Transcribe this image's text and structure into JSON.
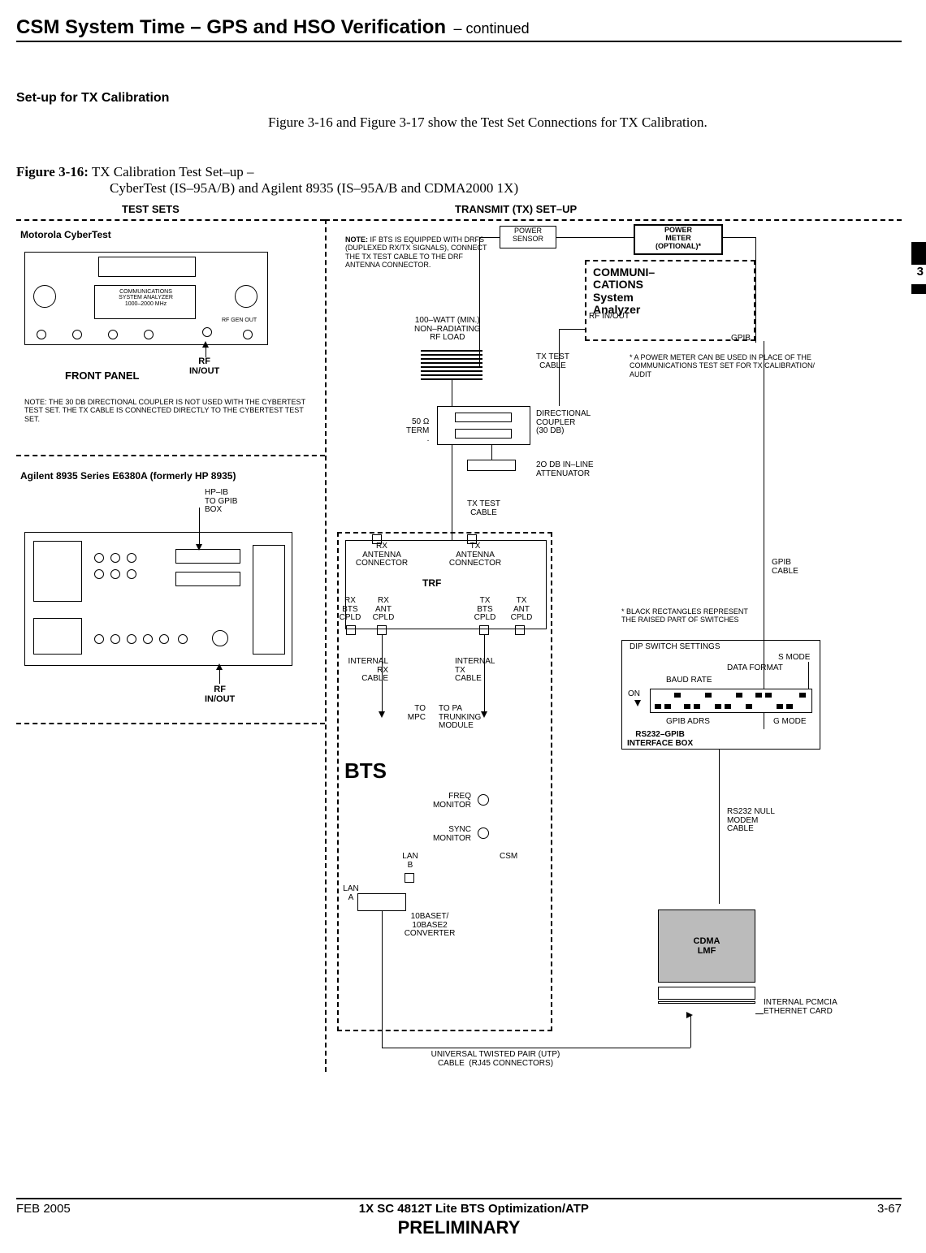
{
  "header": {
    "title": "CSM System Time – GPS and HSO Verification",
    "cont": "– continued"
  },
  "section": {
    "setup": "Set-up for TX Calibration"
  },
  "body": {
    "para1": "Figure 3-16 and Figure 3-17 show the Test Set Connections for TX Calibration."
  },
  "figure": {
    "num": "Figure 3-16:",
    "title": " TX Calibration Test Set–up –",
    "sub": "CyberTest (IS–95A/B) and Agilent 8935 (IS–95A/B and CDMA2000 1X)"
  },
  "diagram": {
    "test_sets_hdr": "TEST SETS",
    "tx_hdr": "TRANSMIT (TX) SET–UP",
    "cybertest_title": "Motorola CyberTest",
    "comm_sys_an": "COMMUNICATIONS\nSYSTEM ANALYZER\n1000–2000 MHz",
    "rf_gen_out": "RF GEN OUT",
    "rf_inout": "RF\nIN/OUT",
    "front_panel": "FRONT PANEL",
    "note30db": "NOTE: THE 30 DB DIRECTIONAL COUPLER IS NOT USED WITH THE CYBERTEST TEST SET. THE TX CABLE IS CONNECTED DIRECTLY TO THE CYBERTEST TEST SET.",
    "agilent_title": "Agilent 8935 Series E6380A (formerly HP 8935)",
    "hpib": "HP–IB\nTO GPIB\nBOX",
    "note_drfs": "NOTE:  IF BTS IS EQUIPPED WITH DRFS (DUPLEXED RX/TX SIGNALS), CONNECT THE TX TEST CABLE TO THE DRF ANTENNA CONNECTOR.",
    "power_sensor": "POWER\nSENSOR",
    "power_meter": "POWER\nMETER\n(OPTIONAL)*",
    "analyzer": "COMMUNI–\nCATIONS\nSystem\nAnalyzer",
    "rfload": "100–WATT (MIN.)\nNON–RADIATING\nRF LOAD",
    "rf_in_out2": "RF IN/OUT",
    "tx_test_cable": "TX TEST\nCABLE",
    "gpib": "GPIB",
    "pm_note": "* A POWER METER CAN BE USED IN PLACE OF THE COMMUNICATIONS TEST SET FOR TX CALIBRATION/ AUDIT",
    "term50": "50 Ω\nTERM\n.",
    "dir_coupler": "DIRECTIONAL\nCOUPLER\n(30 DB)",
    "atten": "2O DB IN–LINE\nATTENUATOR",
    "tx_test_cable2": "TX TEST\nCABLE",
    "gpib_cable": "GPIB\nCABLE",
    "rx_ant_conn": "RX\nANTENNA\nCONNECTOR",
    "tx_ant_conn": "TX\nANTENNA\nCONNECTOR",
    "trf": "TRF",
    "rx_bts_cpld": "RX\nBTS\nCPLD",
    "rx_ant_cpld": "RX\nANT\nCPLD",
    "tx_bts_cpld": "TX\nBTS\nCPLD",
    "tx_ant_cpld": "TX\nANT\nCPLD",
    "int_rx": "INTERNAL\nRX\nCABLE",
    "int_tx": "INTERNAL\nTX\nCABLE",
    "to_mpc": "TO\nMPC",
    "to_pa": "TO PA\nTRUNKING\nMODULE",
    "bts": "BTS",
    "freq_mon": "FREQ\nMONITOR",
    "sync_mon": "SYNC\nMONITOR",
    "csm": "CSM",
    "lan_a": "LAN\nA",
    "lan_b": "LAN\nB",
    "converter": "10BASET/\n10BASE2\nCONVERTER",
    "utp": "UNIVERSAL TWISTED PAIR (UTP)\nCABLE  (RJ45 CONNECTORS)",
    "black_rect_note": "* BLACK RECTANGLES REPRESENT THE RAISED PART OF SWITCHES",
    "dip_settings": "DIP SWITCH SETTINGS",
    "s_mode": "S MODE",
    "data_format": "DATA FORMAT",
    "baud_rate": "BAUD RATE",
    "on": "ON",
    "gpib_adrs": "GPIB ADRS",
    "g_mode": "G MODE",
    "rs232_box": "RS232–GPIB\nINTERFACE BOX",
    "rs232_cable": "RS232 NULL\nMODEM\nCABLE",
    "cdma_lmf": "CDMA\nLMF",
    "pcmcia": "INTERNAL PCMCIA\nETHERNET CARD"
  },
  "sidebar": {
    "chapter": "3"
  },
  "footer": {
    "left": "FEB 2005",
    "mid": "1X SC 4812T Lite BTS Optimization/ATP",
    "right": "3-67",
    "prelim": "PRELIMINARY"
  }
}
